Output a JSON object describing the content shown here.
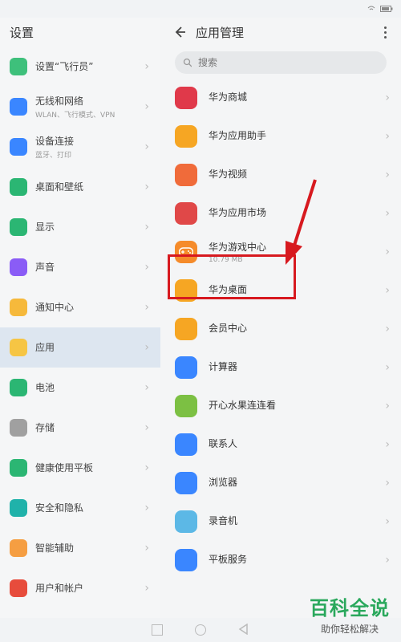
{
  "status": {
    "left": "",
    "right": ""
  },
  "left_pane": {
    "title": "设置"
  },
  "settings_items": [
    {
      "title": "设置“飞行员”",
      "sub": "",
      "color": "#3ec07b"
    },
    {
      "title": "无线和网络",
      "sub": "WLAN、飞行模式、VPN",
      "color": "#3a86ff"
    },
    {
      "title": "设备连接",
      "sub": "蓝牙、打印",
      "color": "#3a86ff"
    },
    {
      "title": "桌面和壁纸",
      "sub": "",
      "color": "#2bb673"
    },
    {
      "title": "显示",
      "sub": "",
      "color": "#2bb673"
    },
    {
      "title": "声音",
      "sub": "",
      "color": "#8a5cf6"
    },
    {
      "title": "通知中心",
      "sub": "",
      "color": "#f6b93b"
    },
    {
      "title": "应用",
      "sub": "",
      "color": "#f6c544",
      "active": true
    },
    {
      "title": "电池",
      "sub": "",
      "color": "#2bb673"
    },
    {
      "title": "存储",
      "sub": "",
      "color": "#a0a0a0"
    },
    {
      "title": "健康使用平板",
      "sub": "",
      "color": "#2bb673"
    },
    {
      "title": "安全和隐私",
      "sub": "",
      "color": "#20b2aa"
    },
    {
      "title": "智能辅助",
      "sub": "",
      "color": "#f59e42"
    },
    {
      "title": "用户和帐户",
      "sub": "",
      "color": "#e74c3c"
    }
  ],
  "right_pane": {
    "title": "应用管理",
    "search_placeholder": "搜索"
  },
  "apps": [
    {
      "name": "华为商城",
      "size": "",
      "color": "#e0394a"
    },
    {
      "name": "华为应用助手",
      "size": "",
      "color": "#f6a623"
    },
    {
      "name": "华为视频",
      "size": "",
      "color": "#f06b3a"
    },
    {
      "name": "华为应用市场",
      "size": "",
      "color": "#e04848"
    },
    {
      "name": "华为游戏中心",
      "size": "10.79 MB",
      "color": "#f58b2a",
      "highlight": true
    },
    {
      "name": "华为桌面",
      "size": "",
      "color": "#f6a623"
    },
    {
      "name": "会员中心",
      "size": "",
      "color": "#f6a623"
    },
    {
      "name": "计算器",
      "size": "",
      "color": "#3a86ff"
    },
    {
      "name": "开心水果连连看",
      "size": "",
      "color": "#7cc043"
    },
    {
      "name": "联系人",
      "size": "",
      "color": "#3a86ff"
    },
    {
      "name": "浏览器",
      "size": "",
      "color": "#3a86ff"
    },
    {
      "name": "录音机",
      "size": "",
      "color": "#5cb8e6"
    },
    {
      "name": "平板服务",
      "size": "",
      "color": "#3a86ff"
    }
  ],
  "watermark": {
    "main": "百科全说",
    "sub": "助你轻松解决"
  }
}
